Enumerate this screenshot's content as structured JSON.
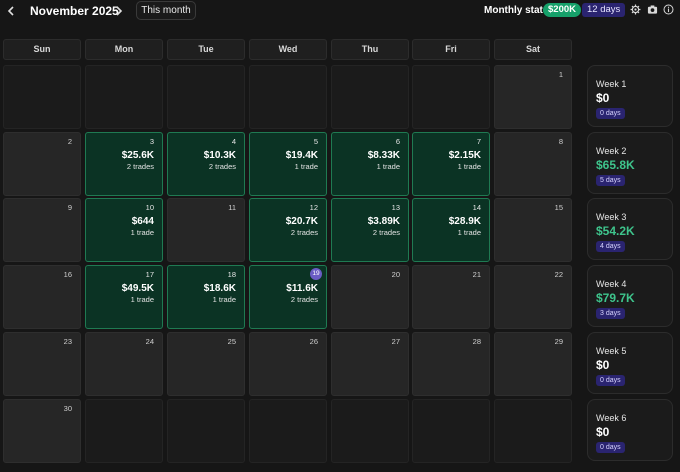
{
  "header": {
    "prev_icon": "chevron-left-icon",
    "next_icon": "chevron-right-icon",
    "month_title": "November 2025",
    "this_month_label": "This month",
    "stats_label": "Monthly stats:",
    "stats_pnl": "$200K",
    "stats_days": "12 days",
    "tool_icons": [
      "gear-icon",
      "camera-icon",
      "info-icon"
    ]
  },
  "weekdays": [
    "Sun",
    "Mon",
    "Tue",
    "Wed",
    "Thu",
    "Fri",
    "Sat"
  ],
  "weeks": [
    {
      "days": [
        {
          "day": "",
          "in_month": false
        },
        {
          "day": "",
          "in_month": false
        },
        {
          "day": "",
          "in_month": false
        },
        {
          "day": "",
          "in_month": false
        },
        {
          "day": "",
          "in_month": false
        },
        {
          "day": "",
          "in_month": false
        },
        {
          "day": "1",
          "in_month": true
        }
      ],
      "summary": {
        "label": "Week 1",
        "pnl": "$0",
        "days": "0 days"
      }
    },
    {
      "days": [
        {
          "day": "2",
          "in_month": true
        },
        {
          "day": "3",
          "in_month": true,
          "pnl": "$25.6K",
          "trades": "2 trades"
        },
        {
          "day": "4",
          "in_month": true,
          "pnl": "$10.3K",
          "trades": "2 trades"
        },
        {
          "day": "5",
          "in_month": true,
          "pnl": "$19.4K",
          "trades": "1 trade"
        },
        {
          "day": "6",
          "in_month": true,
          "pnl": "$8.33K",
          "trades": "1 trade"
        },
        {
          "day": "7",
          "in_month": true,
          "pnl": "$2.15K",
          "trades": "1 trade"
        },
        {
          "day": "8",
          "in_month": true
        }
      ],
      "summary": {
        "label": "Week 2",
        "pnl": "$65.8K",
        "days": "5 days"
      }
    },
    {
      "days": [
        {
          "day": "9",
          "in_month": true
        },
        {
          "day": "10",
          "in_month": true,
          "pnl": "$644",
          "trades": "1 trade"
        },
        {
          "day": "11",
          "in_month": true
        },
        {
          "day": "12",
          "in_month": true,
          "pnl": "$20.7K",
          "trades": "2 trades"
        },
        {
          "day": "13",
          "in_month": true,
          "pnl": "$3.89K",
          "trades": "2 trades"
        },
        {
          "day": "14",
          "in_month": true,
          "pnl": "$28.9K",
          "trades": "1 trade"
        },
        {
          "day": "15",
          "in_month": true
        }
      ],
      "summary": {
        "label": "Week 3",
        "pnl": "$54.2K",
        "days": "4 days"
      }
    },
    {
      "days": [
        {
          "day": "16",
          "in_month": true
        },
        {
          "day": "17",
          "in_month": true,
          "pnl": "$49.5K",
          "trades": "1 trade"
        },
        {
          "day": "18",
          "in_month": true,
          "pnl": "$18.6K",
          "trades": "1 trade"
        },
        {
          "day": "19",
          "in_month": true,
          "today": true,
          "pnl": "$11.6K",
          "trades": "2 trades"
        },
        {
          "day": "20",
          "in_month": true
        },
        {
          "day": "21",
          "in_month": true
        },
        {
          "day": "22",
          "in_month": true
        }
      ],
      "summary": {
        "label": "Week 4",
        "pnl": "$79.7K",
        "days": "3 days"
      }
    },
    {
      "days": [
        {
          "day": "23",
          "in_month": true
        },
        {
          "day": "24",
          "in_month": true
        },
        {
          "day": "25",
          "in_month": true
        },
        {
          "day": "26",
          "in_month": true
        },
        {
          "day": "27",
          "in_month": true
        },
        {
          "day": "28",
          "in_month": true
        },
        {
          "day": "29",
          "in_month": true
        }
      ],
      "summary": {
        "label": "Week 5",
        "pnl": "$0",
        "days": "0 days"
      }
    },
    {
      "days": [
        {
          "day": "30",
          "in_month": true
        },
        {
          "day": "",
          "in_month": false
        },
        {
          "day": "",
          "in_month": false
        },
        {
          "day": "",
          "in_month": false
        },
        {
          "day": "",
          "in_month": false
        },
        {
          "day": "",
          "in_month": false
        },
        {
          "day": "",
          "in_month": false
        }
      ],
      "summary": {
        "label": "Week 6",
        "pnl": "$0",
        "days": "0 days"
      }
    }
  ],
  "colors": {
    "profit_badge": "#16a06a",
    "profit_text": "#3ec48c",
    "trade_cell_bg": "#0b3324",
    "trade_cell_border": "#1f7a52",
    "days_badge": "#2a2470",
    "today_marker": "#6a5cc4"
  }
}
